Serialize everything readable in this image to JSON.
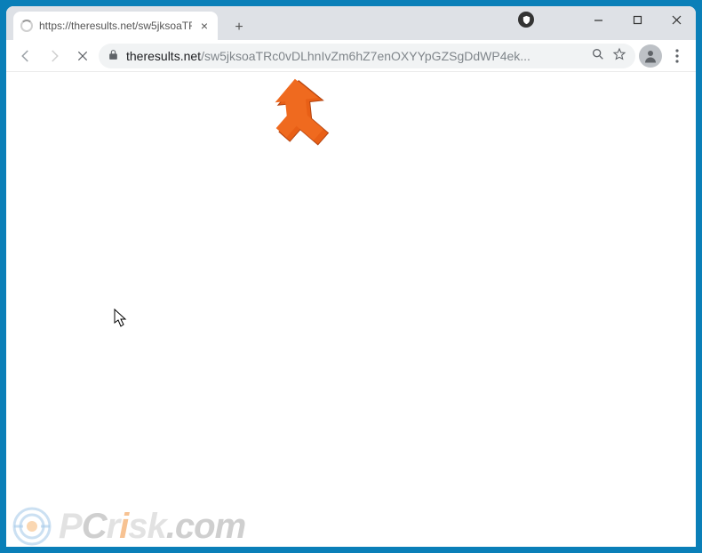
{
  "tab": {
    "title": "https://theresults.net/sw5jksoaTR",
    "close_label": "×"
  },
  "titlebar": {
    "new_tab": "+",
    "minimize": "—",
    "maximize": "□",
    "close": "×"
  },
  "addr": {
    "host": "theresults.net",
    "path": "/sw5jksoaTRc0vDLhnIvZm6hZ7enOXYYpGZSgDdWP4ek..."
  },
  "watermark": {
    "p": "P",
    "c": "C",
    "r": "r",
    "i": "i",
    "s": "s",
    "k": "k",
    "dot": ".",
    "com_c": "c",
    "com_o": "o",
    "com_m": "m"
  }
}
